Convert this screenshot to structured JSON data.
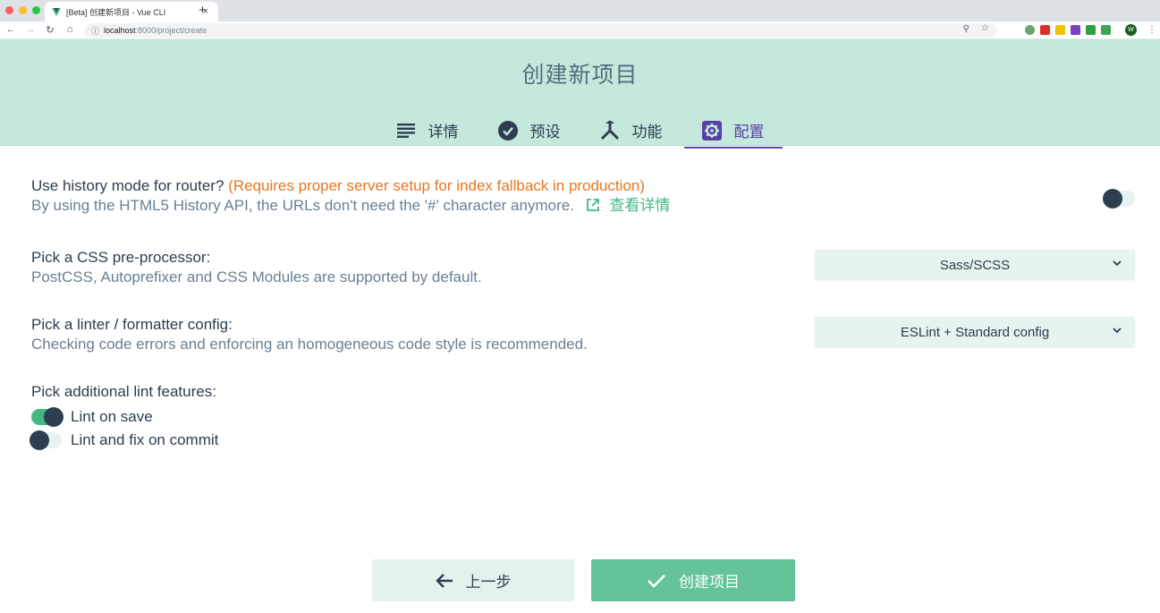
{
  "browser": {
    "tab_title": "[Beta] 创建新项目 - Vue CLI",
    "tab_close": "×",
    "new_tab": "+",
    "url_host": "localhost",
    "url_path": ":8000/project/create",
    "profile_initial": "W"
  },
  "header": {
    "title": "创建新项目",
    "steps": [
      {
        "label": "详情",
        "icon": "details-lines-icon",
        "active": false
      },
      {
        "label": "预设",
        "icon": "check-circle-icon",
        "active": false
      },
      {
        "label": "功能",
        "icon": "call-split-icon",
        "active": false
      },
      {
        "label": "配置",
        "icon": "settings-gear-icon",
        "active": true
      }
    ]
  },
  "prompts": {
    "history": {
      "title": "Use history mode for router?",
      "warning": "(Requires proper server setup for index fallback in production)",
      "description": "By using the HTML5 History API, the URLs don't need the '#' character anymore.",
      "link": "查看详情",
      "enabled": false
    },
    "css": {
      "title": "Pick a CSS pre-processor:",
      "description": "PostCSS, Autoprefixer and CSS Modules are supported by default.",
      "selected": "Sass/SCSS"
    },
    "linter": {
      "title": "Pick a linter / formatter config:",
      "description": "Checking code errors and enforcing an homogeneous code style is recommended.",
      "selected": "ESLint + Standard config"
    },
    "lint_features": {
      "title": "Pick additional lint features:",
      "options": [
        {
          "label": "Lint on save",
          "checked": true
        },
        {
          "label": "Lint and fix on commit",
          "checked": false
        }
      ]
    }
  },
  "actions": {
    "prev_label": "上一步",
    "create_label": "创建项目"
  },
  "colors": {
    "header_bg": "#c4e8dc",
    "accent_green": "#42b983",
    "active_step": "#5e45b0",
    "warning": "#e8761f"
  }
}
